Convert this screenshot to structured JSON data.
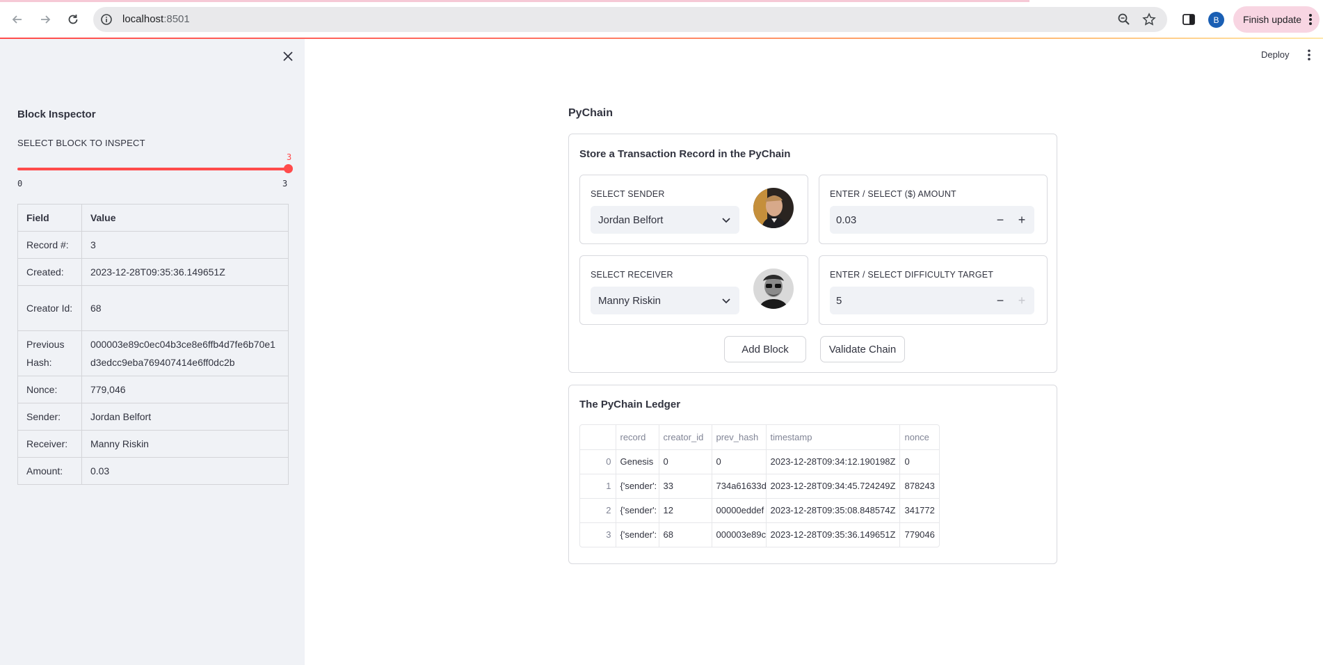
{
  "browser": {
    "url_host": "localhost",
    "url_port": ":8501",
    "profile_initial": "B",
    "finish_update_label": "Finish update"
  },
  "sidebar": {
    "title": "Block Inspector",
    "slider_label": "SELECT BLOCK TO INSPECT",
    "slider_value": "3",
    "slider_min": "0",
    "slider_max": "3",
    "slider_fraction": 1.0,
    "table": {
      "headers": [
        "Field",
        "Value"
      ],
      "rows": [
        {
          "field": "Record #:",
          "value": "3"
        },
        {
          "field": "Created:",
          "value": "2023-12-28T09:35:36.149651Z"
        },
        {
          "field": "Creator Id:",
          "value": "68"
        },
        {
          "field": "Previous Hash:",
          "value": "000003e89c0ec04b3ce8e6ffb4d7fe6b70e1d3edcc9eba769407414e6ff0dc2b"
        },
        {
          "field": "Nonce:",
          "value": "779,046"
        },
        {
          "field": "Sender:",
          "value": "Jordan Belfort"
        },
        {
          "field": "Receiver:",
          "value": "Manny Riskin"
        },
        {
          "field": "Amount:",
          "value": "0.03"
        }
      ]
    }
  },
  "header": {
    "deploy_label": "Deploy"
  },
  "main": {
    "title": "PyChain",
    "form": {
      "title": "Store a Transaction Record in the PyChain",
      "sender_label": "SELECT SENDER",
      "sender_value": "Jordan Belfort",
      "receiver_label": "SELECT RECEIVER",
      "receiver_value": "Manny Riskin",
      "amount_label": "ENTER / SELECT ($) AMOUNT",
      "amount_value": "0.03",
      "difficulty_label": "ENTER / SELECT DIFFICULTY TARGET",
      "difficulty_value": "5",
      "minus": "−",
      "plus": "+",
      "add_block_label": "Add Block",
      "validate_label": "Validate Chain"
    },
    "ledger": {
      "title": "The PyChain Ledger",
      "columns": [
        "",
        "record",
        "creator_id",
        "prev_hash",
        "timestamp",
        "nonce"
      ],
      "rows": [
        {
          "index": "0",
          "record": "Genesis",
          "creator_id": "0",
          "prev_hash": "0",
          "timestamp": "2023-12-28T09:34:12.190198Z",
          "nonce": "0"
        },
        {
          "index": "1",
          "record": "{'sender':",
          "creator_id": "33",
          "prev_hash": "734a61633d",
          "timestamp": "2023-12-28T09:34:45.724249Z",
          "nonce": "878243"
        },
        {
          "index": "2",
          "record": "{'sender':",
          "creator_id": "12",
          "prev_hash": "00000eddef",
          "timestamp": "2023-12-28T09:35:08.848574Z",
          "nonce": "341772"
        },
        {
          "index": "3",
          "record": "{'sender':",
          "creator_id": "68",
          "prev_hash": "000003e89c",
          "timestamp": "2023-12-28T09:35:36.149651Z",
          "nonce": "779046"
        }
      ]
    }
  },
  "colors": {
    "accent": "#ff4b4b",
    "sidebar_bg": "#f0f2f6",
    "text": "#31333f"
  }
}
